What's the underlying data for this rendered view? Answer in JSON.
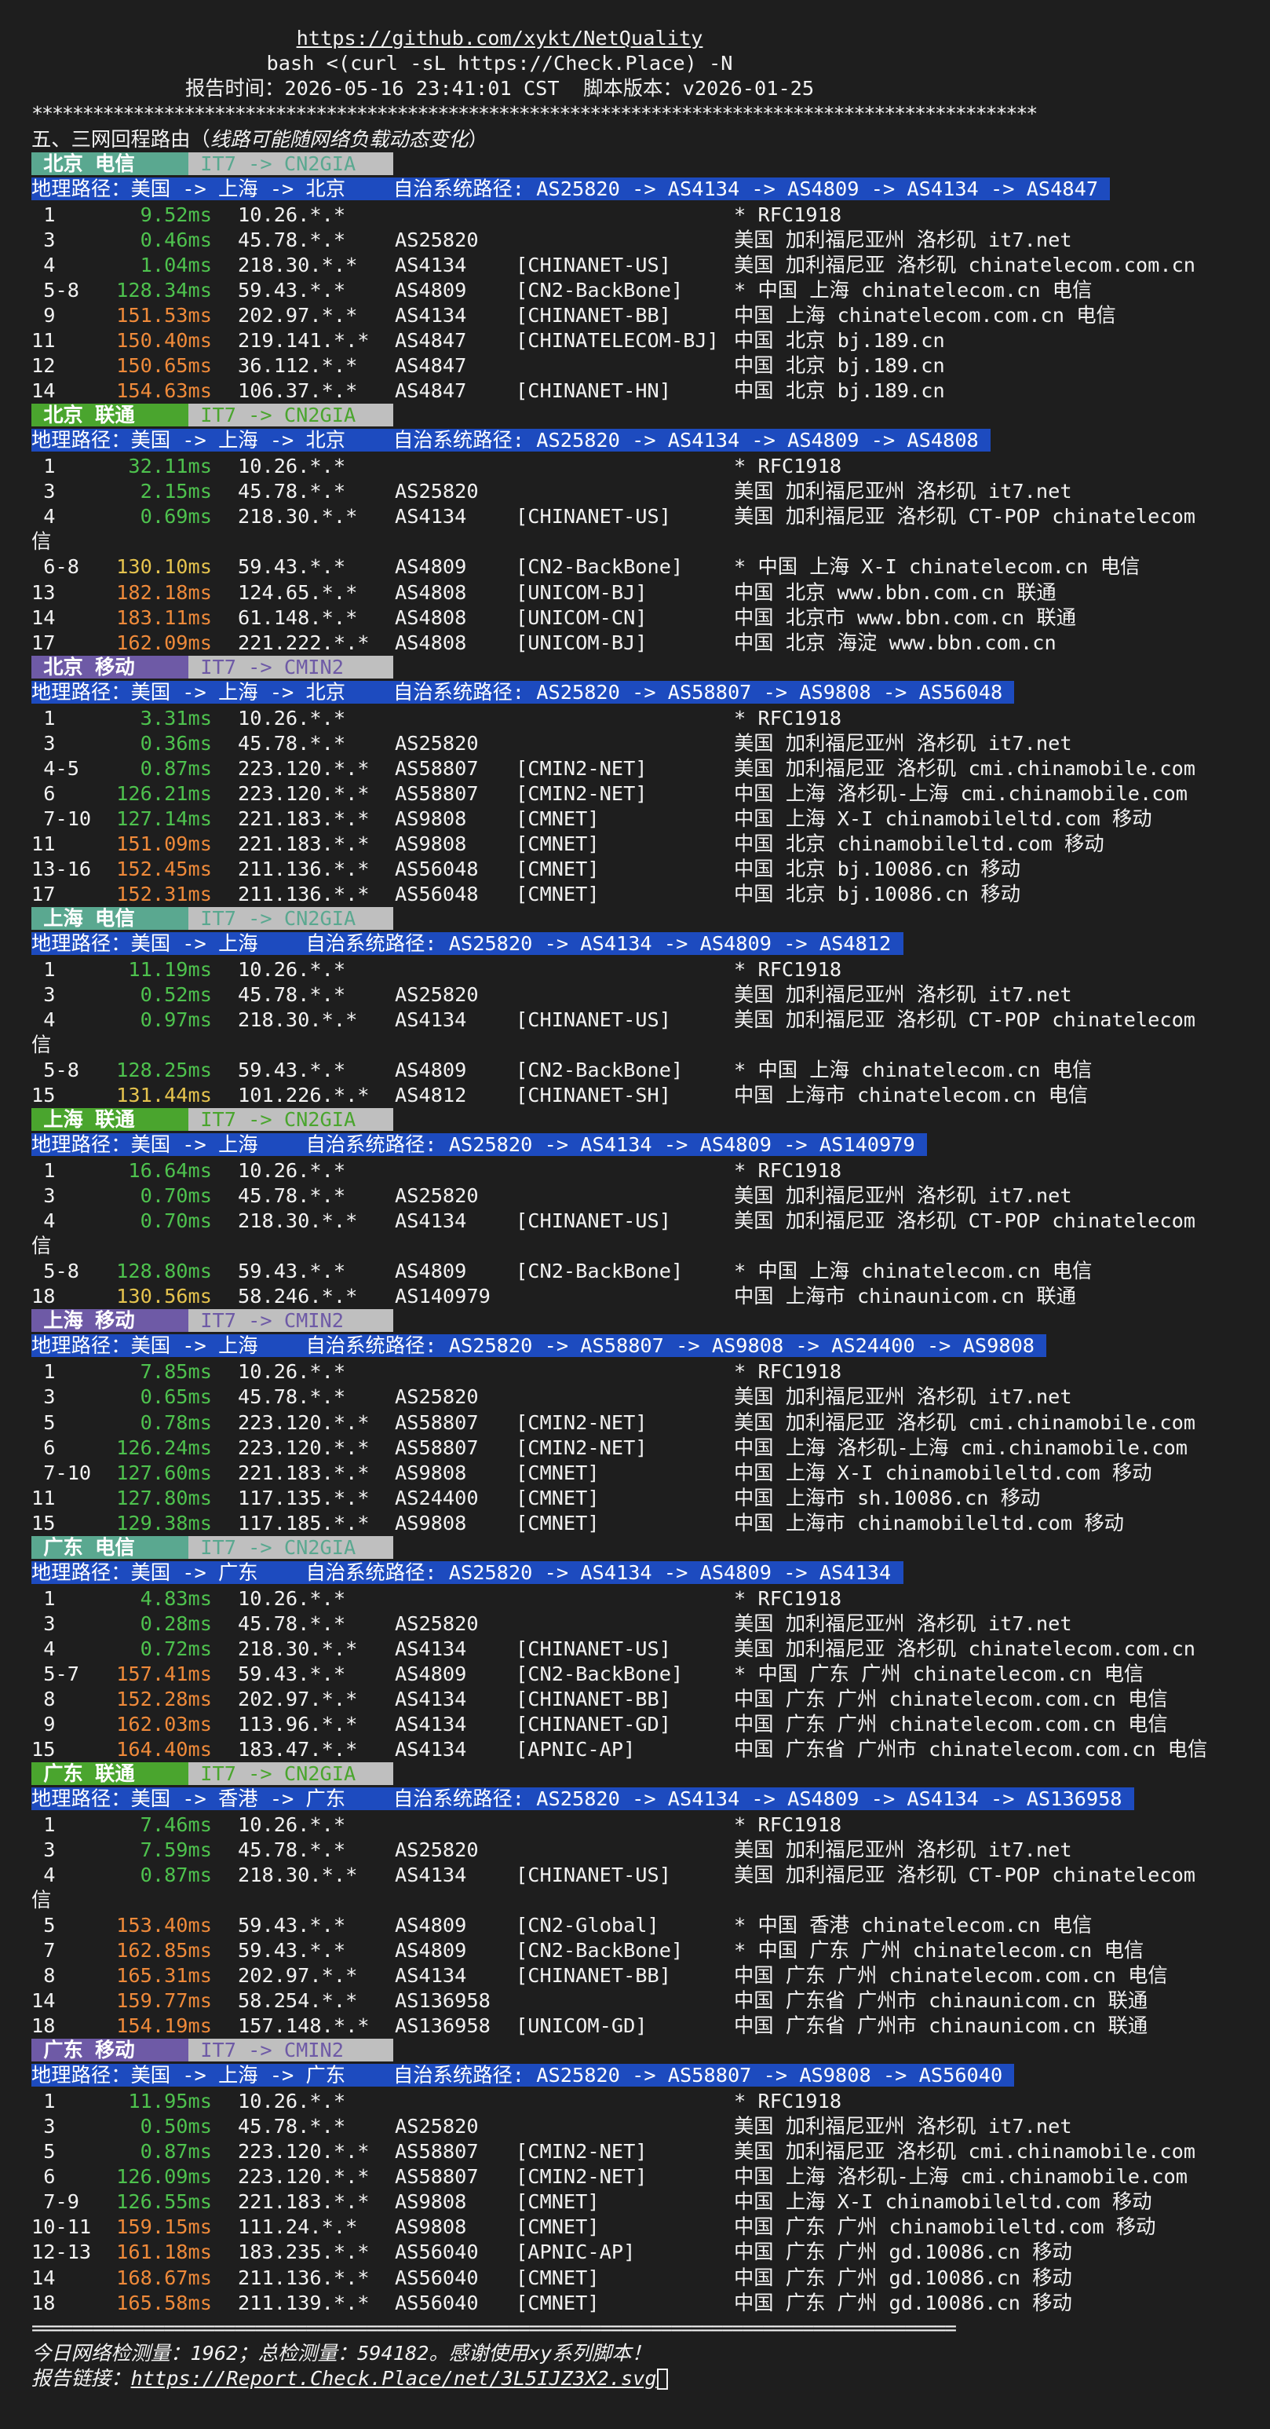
{
  "header": {
    "url": "https://github.com/xykt/NetQuality",
    "command": "bash <(curl -sL https://Check.Place) -N",
    "report_time_label": "报告时间：",
    "report_time": "2026-05-16 23:41:01 CST",
    "version_label": "脚本版本：",
    "version": "v2026-01-25",
    "stars": "***************************************************************************************************",
    "section_title_prefix": "五、三网回程路由（",
    "section_title_note": "线路可能随网络负载动态变化",
    "section_title_suffix": "）"
  },
  "colors": {
    "telecom": "#5aa890",
    "unicom": "#4aa52e",
    "mobile": "#6e5aa6",
    "route_bg": "#bfbfbf",
    "geo_bg": "#1d4bbf",
    "lat_green": "#4ec24e",
    "lat_yellow": "#e5c34e",
    "lat_orange": "#ef8a3a"
  },
  "blocks": [
    {
      "name": " 北京 电信 ",
      "carrier": "telecom",
      "route": " IT7 -> CN2GIA ",
      "geo": "地理路径：美国 -> 上海 -> 北京    自治系统路径: AS25820 -> AS4134 -> AS4809 -> AS4134 -> AS4847 ",
      "rows": [
        {
          "hop": " 1",
          "lat": "9.52ms",
          "ip": "10.26.*.*",
          "asn": "",
          "org": "",
          "loc": "* RFC1918"
        },
        {
          "hop": " 3",
          "lat": "0.46ms",
          "ip": "45.78.*.*",
          "asn": "AS25820",
          "org": "",
          "loc": "美国 加利福尼亚州 洛杉矶 it7.net"
        },
        {
          "hop": " 4",
          "lat": "1.04ms",
          "ip": "218.30.*.*",
          "asn": "AS4134",
          "org": "[CHINANET-US]",
          "loc": "美国 加利福尼亚 洛杉矶 chinatelecom.com.cn"
        },
        {
          "hop": " 5-8",
          "lat": "128.34ms",
          "ip": "59.43.*.*",
          "asn": "AS4809",
          "org": "[CN2-BackBone]",
          "loc": "* 中国 上海 chinatelecom.cn 电信"
        },
        {
          "hop": " 9",
          "lat": "151.53ms",
          "ip": "202.97.*.*",
          "asn": "AS4134",
          "org": "[CHINANET-BB]",
          "loc": "中国 上海 chinatelecom.com.cn 电信"
        },
        {
          "hop": "11",
          "lat": "150.40ms",
          "ip": "219.141.*.*",
          "asn": "AS4847",
          "org": "[CHINATELECOM-BJ]",
          "loc": "中国 北京 bj.189.cn"
        },
        {
          "hop": "12",
          "lat": "150.65ms",
          "ip": "36.112.*.*",
          "asn": "AS4847",
          "org": "",
          "loc": "中国 北京 bj.189.cn"
        },
        {
          "hop": "14",
          "lat": "154.63ms",
          "ip": "106.37.*.*",
          "asn": "AS4847",
          "org": "[CHINANET-HN]",
          "loc": "中国 北京 bj.189.cn"
        }
      ]
    },
    {
      "name": " 北京 联通 ",
      "carrier": "unicom",
      "route": " IT7 -> CN2GIA ",
      "geo": "地理路径：美国 -> 上海 -> 北京    自治系统路径: AS25820 -> AS4134 -> AS4809 -> AS4808 ",
      "rows": [
        {
          "hop": " 1",
          "lat": "32.11ms",
          "ip": "10.26.*.*",
          "asn": "",
          "org": "",
          "loc": "* RFC1918"
        },
        {
          "hop": " 3",
          "lat": "2.15ms",
          "ip": "45.78.*.*",
          "asn": "AS25820",
          "org": "",
          "loc": "美国 加利福尼亚州 洛杉矶 it7.net"
        },
        {
          "hop": " 4",
          "lat": "0.69ms",
          "ip": "218.30.*.*",
          "asn": "AS4134",
          "org": "[CHINANET-US]",
          "loc": "美国 加利福尼亚 洛杉矶 CT-POP chinatelecom",
          "wrap": "信"
        },
        {
          "hop": " 6-8",
          "lat": "130.10ms",
          "ip": "59.43.*.*",
          "asn": "AS4809",
          "org": "[CN2-BackBone]",
          "loc": "* 中国 上海 X-I chinatelecom.cn 电信"
        },
        {
          "hop": "13",
          "lat": "182.18ms",
          "ip": "124.65.*.*",
          "asn": "AS4808",
          "org": "[UNICOM-BJ]",
          "loc": "中国 北京 www.bbn.com.cn 联通"
        },
        {
          "hop": "14",
          "lat": "183.11ms",
          "ip": "61.148.*.*",
          "asn": "AS4808",
          "org": "[UNICOM-CN]",
          "loc": "中国 北京市 www.bbn.com.cn 联通"
        },
        {
          "hop": "17",
          "lat": "162.09ms",
          "ip": "221.222.*.*",
          "asn": "AS4808",
          "org": "[UNICOM-BJ]",
          "loc": "中国 北京 海淀 www.bbn.com.cn"
        }
      ]
    },
    {
      "name": " 北京 移动 ",
      "carrier": "mobile",
      "route": " IT7 -> CMIN2 ",
      "geo": "地理路径：美国 -> 上海 -> 北京    自治系统路径: AS25820 -> AS58807 -> AS9808 -> AS56048 ",
      "rows": [
        {
          "hop": " 1",
          "lat": "3.31ms",
          "ip": "10.26.*.*",
          "asn": "",
          "org": "",
          "loc": "* RFC1918"
        },
        {
          "hop": " 3",
          "lat": "0.36ms",
          "ip": "45.78.*.*",
          "asn": "AS25820",
          "org": "",
          "loc": "美国 加利福尼亚州 洛杉矶 it7.net"
        },
        {
          "hop": " 4-5",
          "lat": "0.87ms",
          "ip": "223.120.*.*",
          "asn": "AS58807",
          "org": "[CMIN2-NET]",
          "loc": "美国 加利福尼亚 洛杉矶 cmi.chinamobile.com"
        },
        {
          "hop": " 6",
          "lat": "126.21ms",
          "ip": "223.120.*.*",
          "asn": "AS58807",
          "org": "[CMIN2-NET]",
          "loc": "中国 上海 洛杉矶-上海 cmi.chinamobile.com"
        },
        {
          "hop": " 7-10",
          "lat": "127.14ms",
          "ip": "221.183.*.*",
          "asn": "AS9808",
          "org": "[CMNET]",
          "loc": "中国 上海 X-I chinamobileltd.com 移动"
        },
        {
          "hop": "11",
          "lat": "151.09ms",
          "ip": "221.183.*.*",
          "asn": "AS9808",
          "org": "[CMNET]",
          "loc": "中国 北京 chinamobileltd.com 移动"
        },
        {
          "hop": "13-16",
          "lat": "152.45ms",
          "ip": "211.136.*.*",
          "asn": "AS56048",
          "org": "[CMNET]",
          "loc": "中国 北京 bj.10086.cn 移动"
        },
        {
          "hop": "17",
          "lat": "152.31ms",
          "ip": "211.136.*.*",
          "asn": "AS56048",
          "org": "[CMNET]",
          "loc": "中国 北京 bj.10086.cn 移动"
        }
      ]
    },
    {
      "name": " 上海 电信 ",
      "carrier": "telecom",
      "route": " IT7 -> CN2GIA ",
      "geo": "地理路径：美国 -> 上海    自治系统路径: AS25820 -> AS4134 -> AS4809 -> AS4812 ",
      "rows": [
        {
          "hop": " 1",
          "lat": "11.19ms",
          "ip": "10.26.*.*",
          "asn": "",
          "org": "",
          "loc": "* RFC1918"
        },
        {
          "hop": " 3",
          "lat": "0.52ms",
          "ip": "45.78.*.*",
          "asn": "AS25820",
          "org": "",
          "loc": "美国 加利福尼亚州 洛杉矶 it7.net"
        },
        {
          "hop": " 4",
          "lat": "0.97ms",
          "ip": "218.30.*.*",
          "asn": "AS4134",
          "org": "[CHINANET-US]",
          "loc": "美国 加利福尼亚 洛杉矶 CT-POP chinatelecom",
          "wrap": "信"
        },
        {
          "hop": " 5-8",
          "lat": "128.25ms",
          "ip": "59.43.*.*",
          "asn": "AS4809",
          "org": "[CN2-BackBone]",
          "loc": "* 中国 上海 chinatelecom.cn 电信"
        },
        {
          "hop": "15",
          "lat": "131.44ms",
          "ip": "101.226.*.*",
          "asn": "AS4812",
          "org": "[CHINANET-SH]",
          "loc": "中国 上海市 chinatelecom.cn 电信"
        }
      ]
    },
    {
      "name": " 上海 联通 ",
      "carrier": "unicom",
      "route": " IT7 -> CN2GIA ",
      "geo": "地理路径：美国 -> 上海    自治系统路径: AS25820 -> AS4134 -> AS4809 -> AS140979 ",
      "rows": [
        {
          "hop": " 1",
          "lat": "16.64ms",
          "ip": "10.26.*.*",
          "asn": "",
          "org": "",
          "loc": "* RFC1918"
        },
        {
          "hop": " 3",
          "lat": "0.70ms",
          "ip": "45.78.*.*",
          "asn": "AS25820",
          "org": "",
          "loc": "美国 加利福尼亚州 洛杉矶 it7.net"
        },
        {
          "hop": " 4",
          "lat": "0.70ms",
          "ip": "218.30.*.*",
          "asn": "AS4134",
          "org": "[CHINANET-US]",
          "loc": "美国 加利福尼亚 洛杉矶 CT-POP chinatelecom",
          "wrap": "信"
        },
        {
          "hop": " 5-8",
          "lat": "128.80ms",
          "ip": "59.43.*.*",
          "asn": "AS4809",
          "org": "[CN2-BackBone]",
          "loc": "* 中国 上海 chinatelecom.cn 电信"
        },
        {
          "hop": "18",
          "lat": "130.56ms",
          "ip": "58.246.*.*",
          "asn": "AS140979",
          "org": "",
          "loc": "中国 上海市 chinaunicom.cn 联通"
        }
      ]
    },
    {
      "name": " 上海 移动 ",
      "carrier": "mobile",
      "route": " IT7 -> CMIN2 ",
      "geo": "地理路径：美国 -> 上海    自治系统路径: AS25820 -> AS58807 -> AS9808 -> AS24400 -> AS9808 ",
      "rows": [
        {
          "hop": " 1",
          "lat": "7.85ms",
          "ip": "10.26.*.*",
          "asn": "",
          "org": "",
          "loc": "* RFC1918"
        },
        {
          "hop": " 3",
          "lat": "0.65ms",
          "ip": "45.78.*.*",
          "asn": "AS25820",
          "org": "",
          "loc": "美国 加利福尼亚州 洛杉矶 it7.net"
        },
        {
          "hop": " 5",
          "lat": "0.78ms",
          "ip": "223.120.*.*",
          "asn": "AS58807",
          "org": "[CMIN2-NET]",
          "loc": "美国 加利福尼亚 洛杉矶 cmi.chinamobile.com"
        },
        {
          "hop": " 6",
          "lat": "126.24ms",
          "ip": "223.120.*.*",
          "asn": "AS58807",
          "org": "[CMIN2-NET]",
          "loc": "中国 上海 洛杉矶-上海 cmi.chinamobile.com"
        },
        {
          "hop": " 7-10",
          "lat": "127.60ms",
          "ip": "221.183.*.*",
          "asn": "AS9808",
          "org": "[CMNET]",
          "loc": "中国 上海 X-I chinamobileltd.com 移动"
        },
        {
          "hop": "11",
          "lat": "127.80ms",
          "ip": "117.135.*.*",
          "asn": "AS24400",
          "org": "[CMNET]",
          "loc": "中国 上海市 sh.10086.cn 移动"
        },
        {
          "hop": "15",
          "lat": "129.38ms",
          "ip": "117.185.*.*",
          "asn": "AS9808",
          "org": "[CMNET]",
          "loc": "中国 上海市 chinamobileltd.com 移动"
        }
      ]
    },
    {
      "name": " 广东 电信 ",
      "carrier": "telecom",
      "route": " IT7 -> CN2GIA ",
      "geo": "地理路径：美国 -> 广东    自治系统路径: AS25820 -> AS4134 -> AS4809 -> AS4134 ",
      "rows": [
        {
          "hop": " 1",
          "lat": "4.83ms",
          "ip": "10.26.*.*",
          "asn": "",
          "org": "",
          "loc": "* RFC1918"
        },
        {
          "hop": " 3",
          "lat": "0.28ms",
          "ip": "45.78.*.*",
          "asn": "AS25820",
          "org": "",
          "loc": "美国 加利福尼亚州 洛杉矶 it7.net"
        },
        {
          "hop": " 4",
          "lat": "0.72ms",
          "ip": "218.30.*.*",
          "asn": "AS4134",
          "org": "[CHINANET-US]",
          "loc": "美国 加利福尼亚 洛杉矶 chinatelecom.com.cn"
        },
        {
          "hop": " 5-7",
          "lat": "157.41ms",
          "ip": "59.43.*.*",
          "asn": "AS4809",
          "org": "[CN2-BackBone]",
          "loc": "* 中国 广东 广州 chinatelecom.cn 电信"
        },
        {
          "hop": " 8",
          "lat": "152.28ms",
          "ip": "202.97.*.*",
          "asn": "AS4134",
          "org": "[CHINANET-BB]",
          "loc": "中国 广东 广州 chinatelecom.com.cn 电信"
        },
        {
          "hop": " 9",
          "lat": "162.03ms",
          "ip": "113.96.*.*",
          "asn": "AS4134",
          "org": "[CHINANET-GD]",
          "loc": "中国 广东 广州 chinatelecom.com.cn 电信"
        },
        {
          "hop": "15",
          "lat": "164.40ms",
          "ip": "183.47.*.*",
          "asn": "AS4134",
          "org": "[APNIC-AP]",
          "loc": "中国 广东省 广州市 chinatelecom.com.cn 电信"
        }
      ]
    },
    {
      "name": " 广东 联通 ",
      "carrier": "unicom",
      "route": " IT7 -> CN2GIA ",
      "geo": "地理路径：美国 -> 香港 -> 广东    自治系统路径: AS25820 -> AS4134 -> AS4809 -> AS4134 -> AS136958 ",
      "rows": [
        {
          "hop": " 1",
          "lat": "7.46ms",
          "ip": "10.26.*.*",
          "asn": "",
          "org": "",
          "loc": "* RFC1918"
        },
        {
          "hop": " 3",
          "lat": "7.59ms",
          "ip": "45.78.*.*",
          "asn": "AS25820",
          "org": "",
          "loc": "美国 加利福尼亚州 洛杉矶 it7.net"
        },
        {
          "hop": " 4",
          "lat": "0.87ms",
          "ip": "218.30.*.*",
          "asn": "AS4134",
          "org": "[CHINANET-US]",
          "loc": "美国 加利福尼亚 洛杉矶 CT-POP chinatelecom",
          "wrap": "信"
        },
        {
          "hop": " 5",
          "lat": "153.40ms",
          "ip": "59.43.*.*",
          "asn": "AS4809",
          "org": "[CN2-Global]",
          "loc": "* 中国 香港 chinatelecom.cn 电信"
        },
        {
          "hop": " 7",
          "lat": "162.85ms",
          "ip": "59.43.*.*",
          "asn": "AS4809",
          "org": "[CN2-BackBone]",
          "loc": "* 中国 广东 广州 chinatelecom.cn 电信"
        },
        {
          "hop": " 8",
          "lat": "165.31ms",
          "ip": "202.97.*.*",
          "asn": "AS4134",
          "org": "[CHINANET-BB]",
          "loc": "中国 广东 广州 chinatelecom.com.cn 电信"
        },
        {
          "hop": "14",
          "lat": "159.77ms",
          "ip": "58.254.*.*",
          "asn": "AS136958",
          "org": "",
          "loc": "中国 广东省 广州市 chinaunicom.cn 联通"
        },
        {
          "hop": "18",
          "lat": "154.19ms",
          "ip": "157.148.*.*",
          "asn": "AS136958",
          "org": "[UNICOM-GD]",
          "loc": "中国 广东省 广州市 chinaunicom.cn 联通"
        }
      ]
    },
    {
      "name": " 广东 移动 ",
      "carrier": "mobile",
      "route": " IT7 -> CMIN2 ",
      "geo": "地理路径：美国 -> 上海 -> 广东    自治系统路径: AS25820 -> AS58807 -> AS9808 -> AS56040 ",
      "rows": [
        {
          "hop": " 1",
          "lat": "11.95ms",
          "ip": "10.26.*.*",
          "asn": "",
          "org": "",
          "loc": "* RFC1918"
        },
        {
          "hop": " 3",
          "lat": "0.50ms",
          "ip": "45.78.*.*",
          "asn": "AS25820",
          "org": "",
          "loc": "美国 加利福尼亚州 洛杉矶 it7.net"
        },
        {
          "hop": " 5",
          "lat": "0.87ms",
          "ip": "223.120.*.*",
          "asn": "AS58807",
          "org": "[CMIN2-NET]",
          "loc": "美国 加利福尼亚 洛杉矶 cmi.chinamobile.com"
        },
        {
          "hop": " 6",
          "lat": "126.09ms",
          "ip": "223.120.*.*",
          "asn": "AS58807",
          "org": "[CMIN2-NET]",
          "loc": "中国 上海 洛杉矶-上海 cmi.chinamobile.com"
        },
        {
          "hop": " 7-9",
          "lat": "126.55ms",
          "ip": "221.183.*.*",
          "asn": "AS9808",
          "org": "[CMNET]",
          "loc": "中国 上海 X-I chinamobileltd.com 移动"
        },
        {
          "hop": "10-11",
          "lat": "159.15ms",
          "ip": "111.24.*.*",
          "asn": "AS9808",
          "org": "[CMNET]",
          "loc": "中国 广东 广州 chinamobileltd.com 移动"
        },
        {
          "hop": "12-13",
          "lat": "161.18ms",
          "ip": "183.235.*.*",
          "asn": "AS56040",
          "org": "[APNIC-AP]",
          "loc": "中国 广东 广州 gd.10086.cn 移动"
        },
        {
          "hop": "14",
          "lat": "168.67ms",
          "ip": "211.136.*.*",
          "asn": "AS56040",
          "org": "[CMNET]",
          "loc": "中国 广东 广州 gd.10086.cn 移动"
        },
        {
          "hop": "18",
          "lat": "165.58ms",
          "ip": "211.139.*.*",
          "asn": "AS56040",
          "org": "[CMNET]",
          "loc": "中国 广东 广州 gd.10086.cn 移动"
        }
      ]
    }
  ],
  "footer": {
    "equals": "===========================================================================================",
    "stats": "今日网络检测量：1962；总检测量：594182。感谢使用xy系列脚本！",
    "report_label": "报告链接：",
    "report_link": "https://Report.Check.Place/net/3L5IJZ3X2.svg"
  }
}
